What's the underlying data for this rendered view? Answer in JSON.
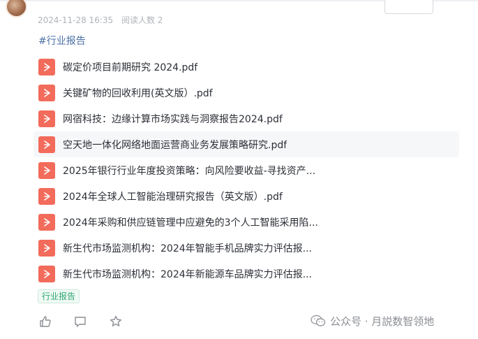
{
  "post": {
    "date": "2024-11-28 16:35",
    "readers": "阅读人数 2",
    "topic": "#行业报告"
  },
  "files": [
    {
      "name": "碳定价项目前期研究 2024.pdf"
    },
    {
      "name": "关键矿物的回收利用(英文版）.pdf"
    },
    {
      "name": "网宿科技：边缘计算市场实践与洞察报告2024.pdf"
    },
    {
      "name": "空天地一体化网络地面运营商业务发展策略研究.pdf"
    },
    {
      "name": "2025年银行行业年度投资策略：向风险要收益-寻找资产..."
    },
    {
      "name": "2024年全球人工智能治理研究报告（英文版）.pdf"
    },
    {
      "name": "2024年采购和供应链管理中应避免的3个人工智能采用陷..."
    },
    {
      "name": "新生代市场监测机构：2024年智能手机品牌实力评估报..."
    },
    {
      "name": "新生代市场监测机构：2024年新能源车品牌实力评估报..."
    }
  ],
  "label": "行业报告",
  "watermark": "公众号 · 月説数智领地",
  "colors": {
    "pdf_icon": "#f26b5b",
    "topic": "#4a6fa5",
    "label_text": "#2fa56f"
  },
  "icons": {
    "like": "thumbs-up-icon",
    "comment": "comment-icon",
    "favorite": "star-icon",
    "file": "pdf-icon",
    "watermark": "wechat-icon"
  }
}
